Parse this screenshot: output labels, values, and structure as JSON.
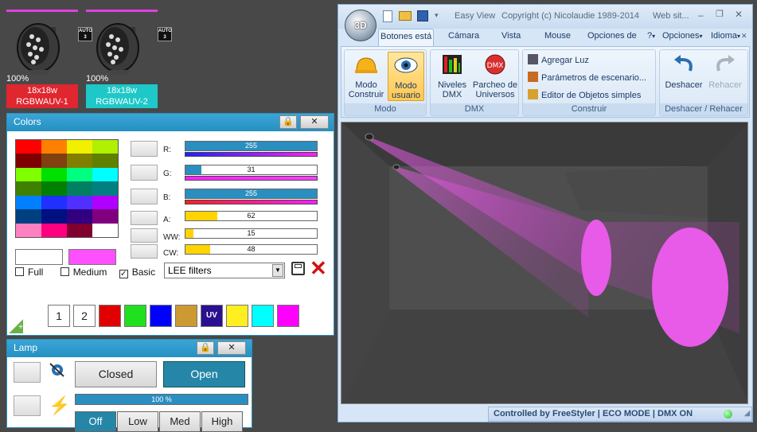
{
  "fixtures": [
    {
      "percent": "100%",
      "name_line1": "18x18w",
      "name_line2": "RGBWAUV-1",
      "label_color": "#e0262f",
      "auto_text": "AUTO 3"
    },
    {
      "percent": "100%",
      "name_line1": "18x18w",
      "name_line2": "RGBWAUV-2",
      "label_color": "#1ec8c8",
      "auto_text": "AUTO 3"
    }
  ],
  "colors_panel": {
    "title": "Colors",
    "swatches": [
      "#ff0000",
      "#ff8000",
      "#f0f000",
      "#b0f000",
      "#7f0000",
      "#804010",
      "#808000",
      "#608000",
      "#80ff00",
      "#00e000",
      "#00ff80",
      "#00ffff",
      "#408000",
      "#008000",
      "#008060",
      "#008080",
      "#0080ff",
      "#2030ff",
      "#5030ff",
      "#b000ff",
      "#004080",
      "#001080",
      "#300080",
      "#800080",
      "#ff80c0",
      "#ff0080",
      "#800030",
      "#ffffff"
    ],
    "current_color": "#ffffff",
    "new_color": "#ff50ff",
    "sliders": [
      {
        "label": "R:",
        "value": "255",
        "fraction": 1.0,
        "fill": "#2a8fc0",
        "underbar": "linear-gradient(90deg,#2020ff,#ff20ff)"
      },
      {
        "label": "G:",
        "value": "31",
        "fraction": 0.12,
        "fill": "#2a8fc0",
        "underbar": "linear-gradient(90deg,#ff20ff,#ff40ff)"
      },
      {
        "label": "B:",
        "value": "255",
        "fraction": 1.0,
        "fill": "#2a8fc0",
        "underbar": "linear-gradient(90deg,#ff2020,#ff20ff)"
      },
      {
        "label": "A:",
        "value": "62",
        "fraction": 0.24,
        "fill": "#ffd400"
      },
      {
        "label": "WW:",
        "value": "15",
        "fraction": 0.06,
        "fill": "#ffd400"
      },
      {
        "label": "CW:",
        "value": "48",
        "fraction": 0.19,
        "fill": "#ffd400"
      }
    ],
    "checkboxes": [
      {
        "label": "Full",
        "checked": ""
      },
      {
        "label": "Medium",
        "checked": ""
      },
      {
        "label": "Basic",
        "checked": "✓"
      }
    ],
    "filter_select": "LEE filters",
    "presets": [
      "1",
      "2"
    ],
    "preset_colors": [
      "#e00000",
      "#20e020",
      "#0000ff",
      "#cc9933",
      "#2a1090",
      "#ffee20",
      "#00ffff",
      "#ff00ff"
    ],
    "uv_label": "UV"
  },
  "lamp_panel": {
    "title": "Lamp",
    "closed": "Closed",
    "open": "Open",
    "progress_text": "100 %",
    "progress_fraction": 1.0,
    "levels": [
      "Off",
      "Low",
      "Med",
      "High"
    ]
  },
  "app": {
    "orb_label": "3D",
    "title": "Easy View",
    "copyright": "Copyright (c) Nicolaudie 1989-2014",
    "website": "Web sit...",
    "tabs": [
      "Botones está",
      "Cámara",
      "Vista",
      "Mouse",
      "Opciones de"
    ],
    "help": "?",
    "options": "Opciones",
    "language": "Idioma",
    "groups": {
      "modo": {
        "label": "Modo",
        "construir": "Modo Construir",
        "usuario": "Modo usuario"
      },
      "dmx": {
        "label": "DMX",
        "niveles": "Niveles DMX",
        "parcheo": "Parcheo de Universos"
      },
      "construir": {
        "label": "Construir",
        "agregar": "Agregar Luz",
        "parametros": "Parámetros de escenario...",
        "editor": "Editor de Objetos simples"
      },
      "deshacer": {
        "label": "Deshacer / Rehacer",
        "deshacer": "Deshacer",
        "rehacer": "Rehacer"
      }
    },
    "status": "Controlled by FreeStyler   |   ECO MODE   |   DMX ON"
  }
}
